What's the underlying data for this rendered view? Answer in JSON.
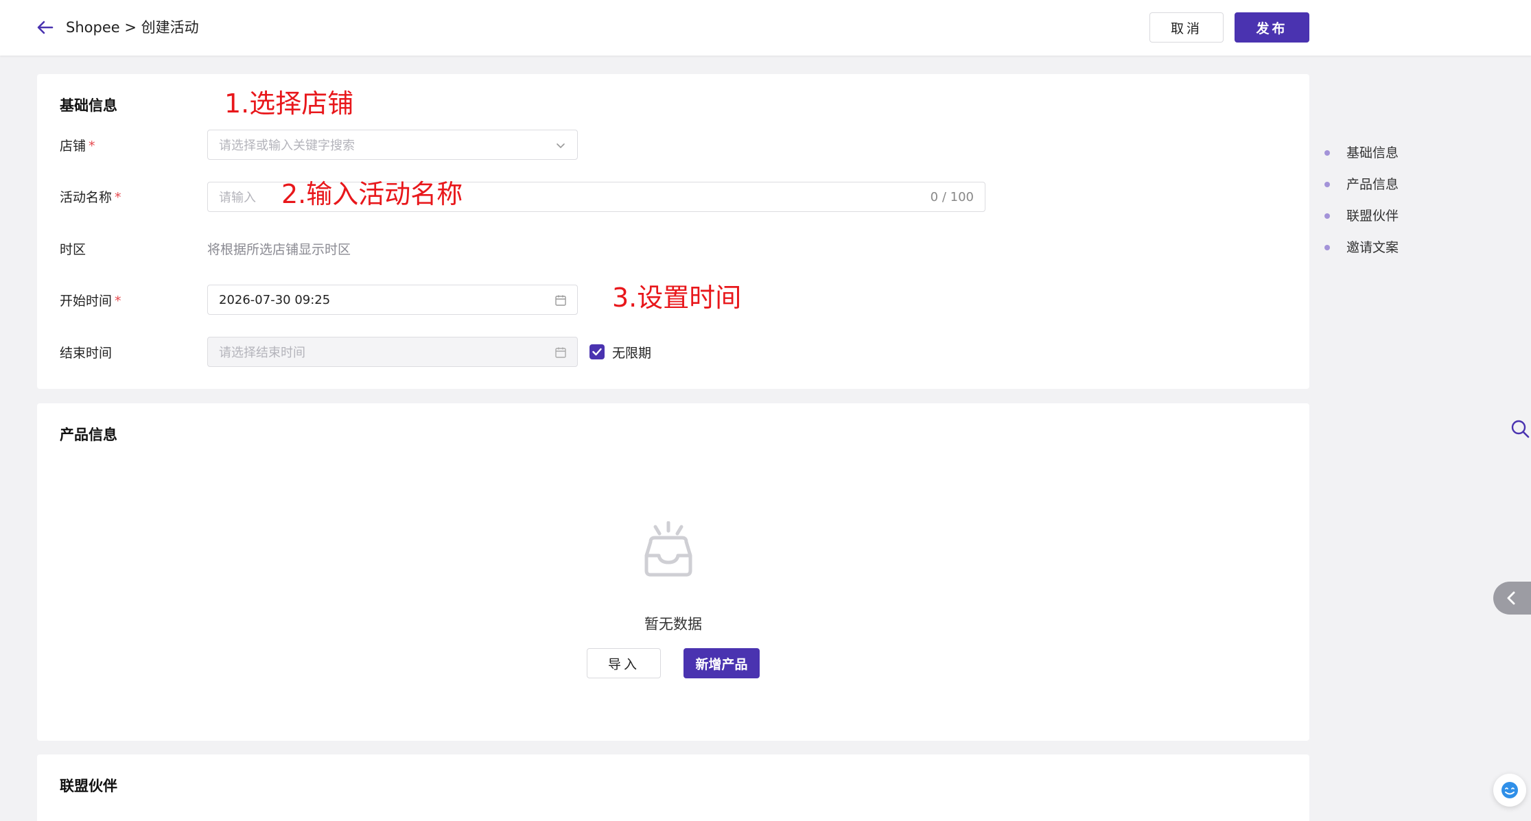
{
  "header": {
    "breadcrumb": "Shopee > 创建活动",
    "cancel_label": "取消",
    "publish_label": "发布"
  },
  "basic": {
    "title": "基础信息",
    "annotation_store": "1.选择店铺",
    "annotation_name": "2.输入活动名称",
    "annotation_time": "3.设置时间",
    "store": {
      "label": "店铺",
      "required_mark": "*",
      "placeholder": "请选择或输入关键字搜索"
    },
    "activity_name": {
      "label": "活动名称",
      "required_mark": "*",
      "placeholder": "请输入",
      "counter": "0 / 100"
    },
    "timezone": {
      "label": "时区",
      "value": "将根据所选店铺显示时区"
    },
    "start_time": {
      "label": "开始时间",
      "required_mark": "*",
      "value": "2026-07-30 09:25"
    },
    "end_time": {
      "label": "结束时间",
      "placeholder": "请选择结束时间",
      "unlimited_label": "无限期",
      "unlimited_checked": true
    }
  },
  "product": {
    "title": "产品信息",
    "empty_text": "暂无数据",
    "import_label": "导入",
    "add_label": "新增产品"
  },
  "partner": {
    "title": "联盟伙伴"
  },
  "anchor_nav": [
    "基础信息",
    "产品信息",
    "联盟伙伴",
    "邀请文案"
  ],
  "colors": {
    "primary": "#4a33b0",
    "annotation": "#e8171b",
    "required": "#e5484d"
  },
  "icons": {
    "back": "arrow-left-icon",
    "dropdown": "chevron-down-icon",
    "calendar": "calendar-icon",
    "check": "check-icon",
    "empty": "empty-inbox-icon",
    "search": "search-icon",
    "collapse": "chevron-left-icon",
    "assistant": "assistant-icon"
  }
}
